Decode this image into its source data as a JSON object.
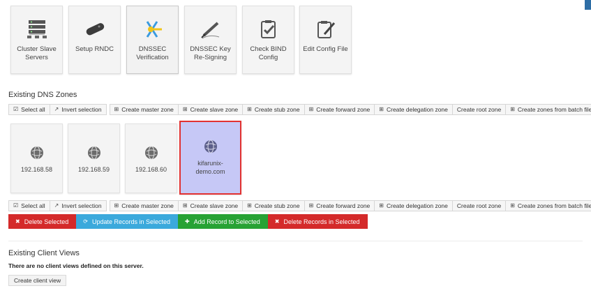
{
  "modules": [
    {
      "label": "Cluster Slave Servers",
      "icon": "server-rack-icon"
    },
    {
      "label": "Setup RNDC",
      "icon": "remote-control-icon"
    },
    {
      "label": "DNSSEC Verification",
      "icon": "key-verification-icon"
    },
    {
      "label": "DNSSEC Key Re-Signing",
      "icon": "pen-signing-icon"
    },
    {
      "label": "Check BIND Config",
      "icon": "clipboard-check-icon"
    },
    {
      "label": "Edit Config File",
      "icon": "clipboard-edit-icon"
    }
  ],
  "zones_section": {
    "title": "Existing DNS Zones"
  },
  "toolbar": {
    "select_all": "Select all",
    "invert_selection": "Invert selection",
    "create_master_zone": "Create master zone",
    "create_slave_zone": "Create slave zone",
    "create_stub_zone": "Create stub zone",
    "create_forward_zone": "Create forward zone",
    "create_delegation_zone": "Create delegation zone",
    "create_root_zone": "Create root zone",
    "create_zones_from_batch": "Create zones from batch file"
  },
  "zones": [
    {
      "label": "192.168.58",
      "selected": false
    },
    {
      "label": "192.168.59",
      "selected": false
    },
    {
      "label": "192.168.60",
      "selected": false
    },
    {
      "label": "kifarunix-demo.com",
      "selected": true
    }
  ],
  "actions": {
    "delete_selected": "Delete Selected",
    "update_records": "Update Records in Selected",
    "add_record": "Add Record to Selected",
    "delete_records": "Delete Records in Selected"
  },
  "views_section": {
    "title": "Existing Client Views",
    "empty_note": "There are no client views defined on this server.",
    "create_button": "Create client view"
  },
  "colors": {
    "selected_zone_bg": "#c6c8f6",
    "selected_zone_border": "#e23131",
    "danger": "#d42a2a",
    "info": "#3ba9dc",
    "success": "#27a234"
  }
}
